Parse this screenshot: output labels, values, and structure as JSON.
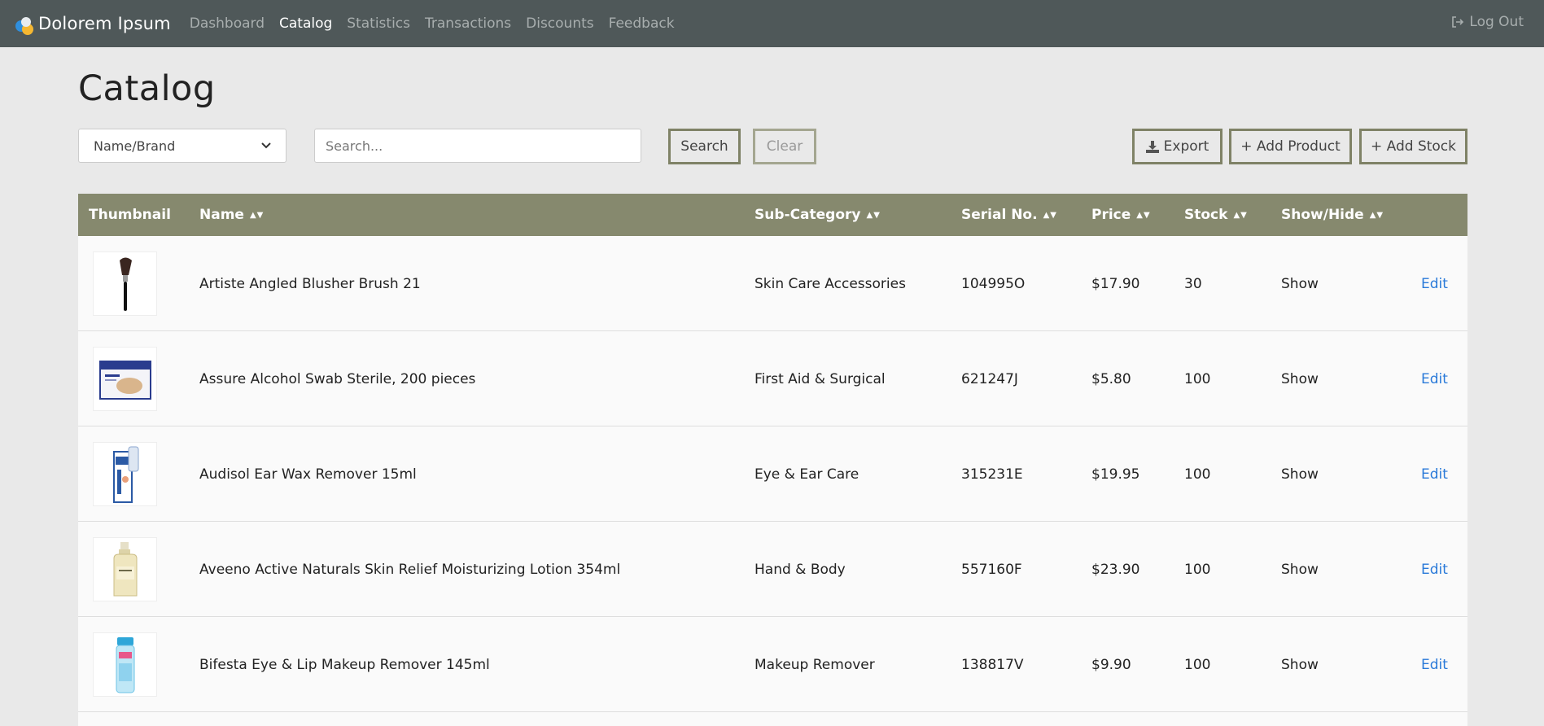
{
  "navbar": {
    "brand": "Dolorem Ipsum",
    "links": [
      "Dashboard",
      "Catalog",
      "Statistics",
      "Transactions",
      "Discounts",
      "Feedback"
    ],
    "active": "Catalog",
    "logout": "Log Out"
  },
  "page": {
    "title": "Catalog"
  },
  "toolbar": {
    "filter_selected": "Name/Brand",
    "search_placeholder": "Search...",
    "search_label": "Search",
    "clear_label": "Clear",
    "export_label": "Export",
    "add_product_label": "+ Add Product",
    "add_stock_label": "+ Add Stock"
  },
  "table": {
    "headers": {
      "thumbnail": "Thumbnail",
      "name": "Name",
      "subcategory": "Sub-Category",
      "serial": "Serial No.",
      "price": "Price",
      "stock": "Stock",
      "showhide": "Show/Hide"
    },
    "rows": [
      {
        "name": "Artiste Angled Blusher Brush 21",
        "subcategory": "Skin Care Accessories",
        "serial": "104995O",
        "price": "$17.90",
        "stock": "30",
        "visibility": "Show",
        "action": "Edit",
        "thumb": "brush"
      },
      {
        "name": "Assure Alcohol Swab Sterile, 200 pieces",
        "subcategory": "First Aid & Surgical",
        "serial": "621247J",
        "price": "$5.80",
        "stock": "100",
        "visibility": "Show",
        "action": "Edit",
        "thumb": "box"
      },
      {
        "name": "Audisol Ear Wax Remover 15ml",
        "subcategory": "Eye & Ear Care",
        "serial": "315231E",
        "price": "$19.95",
        "stock": "100",
        "visibility": "Show",
        "action": "Edit",
        "thumb": "spray"
      },
      {
        "name": "Aveeno Active Naturals Skin Relief Moisturizing Lotion 354ml",
        "subcategory": "Hand & Body",
        "serial": "557160F",
        "price": "$23.90",
        "stock": "100",
        "visibility": "Show",
        "action": "Edit",
        "thumb": "lotion"
      },
      {
        "name": "Bifesta Eye & Lip Makeup Remover 145ml",
        "subcategory": "Makeup Remover",
        "serial": "138817V",
        "price": "$9.90",
        "stock": "100",
        "visibility": "Show",
        "action": "Edit",
        "thumb": "bottle"
      }
    ]
  },
  "colors": {
    "navbar": "#4f5859",
    "table_header": "#86896e",
    "button_border": "#7f8266",
    "link": "#2a7ad9"
  }
}
